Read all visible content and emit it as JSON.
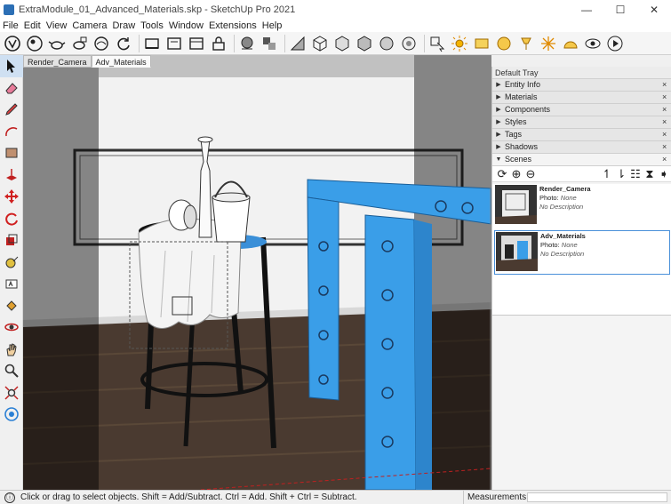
{
  "window": {
    "title": "ExtraModule_01_Advanced_Materials.skp - SketchUp Pro 2021",
    "minimize": "—",
    "maximize": "☐",
    "close": "✕"
  },
  "menu": [
    "File",
    "Edit",
    "View",
    "Camera",
    "Draw",
    "Tools",
    "Window",
    "Extensions",
    "Help"
  ],
  "toolbar_icons": [
    "select-icon",
    "component-icon",
    "teapot-icon",
    "paint-icon",
    "orbit-icon",
    "refresh-icon",
    "ruler-icon",
    "section-icon",
    "window-icon",
    "lock-icon",
    "group-icon",
    "outliner-icon",
    "shade-icon",
    "box-icon",
    "box2-icon",
    "box3-icon",
    "box4-icon",
    "box5-icon",
    "select-mode-icon",
    "sun-icon",
    "material-icon",
    "lamp-icon",
    "light-icon",
    "dome-icon",
    "eye-icon",
    "play-icon"
  ],
  "left_tools": [
    "select-icon",
    "eraser-icon",
    "pencil-icon",
    "arc-icon",
    "rectangle-icon",
    "pushpull-icon",
    "move-icon",
    "rotate-icon",
    "scale-icon",
    "tape-icon",
    "text-icon",
    "paint-bucket-icon",
    "orbit-icon",
    "hand-icon",
    "zoom-icon",
    "zoom-extents-icon",
    "warehouse-icon"
  ],
  "viewport": {
    "scene_tabs": [
      {
        "label": "Render_Camera",
        "active": false
      },
      {
        "label": "Adv_Materials",
        "active": true
      }
    ]
  },
  "tray": {
    "title": "Default Tray",
    "panels": [
      {
        "label": "Entity Info",
        "open": false
      },
      {
        "label": "Materials",
        "open": false
      },
      {
        "label": "Components",
        "open": false
      },
      {
        "label": "Styles",
        "open": false
      },
      {
        "label": "Tags",
        "open": false
      },
      {
        "label": "Shadows",
        "open": false
      },
      {
        "label": "Scenes",
        "open": true
      }
    ],
    "close_glyph": "×",
    "scenes_toolbar": [
      "refresh-icon",
      "add-icon",
      "remove-icon",
      "move-up-icon",
      "move-down-icon",
      "view-options-icon",
      "details-icon",
      "flyout-icon"
    ],
    "scenes": [
      {
        "name": "Render_Camera",
        "photo_label": "Photo:",
        "photo_value": "None",
        "description": "No Description",
        "selected": false
      },
      {
        "name": "Adv_Materials",
        "photo_label": "Photo:",
        "photo_value": "None",
        "description": "No Description",
        "selected": true
      }
    ]
  },
  "status": {
    "text": "Click or drag to select objects. Shift = Add/Subtract. Ctrl = Add. Shift + Ctrl = Subtract.",
    "measurements_label": "Measurements",
    "measurements_value": ""
  },
  "colors": {
    "accent": "#4a90d9",
    "table_blue": "#3a9ee8",
    "floor": "#4a3a30",
    "wall": "#f2f2f2"
  }
}
